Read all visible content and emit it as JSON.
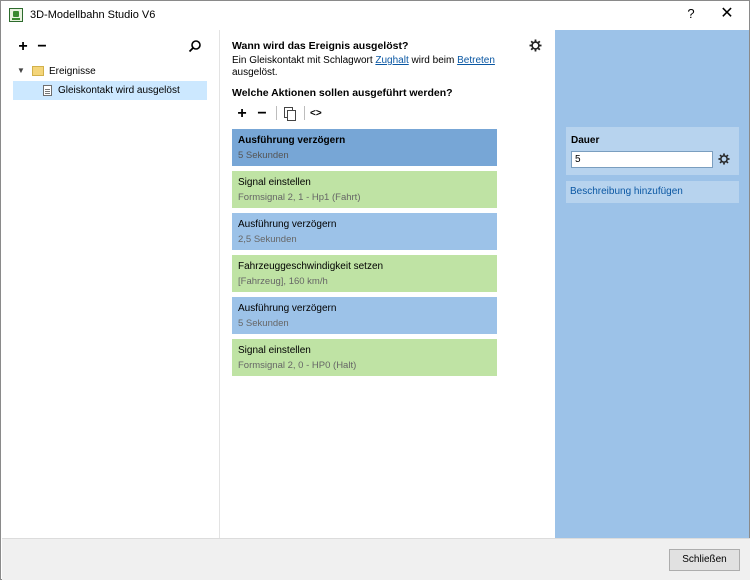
{
  "window": {
    "title": "3D-Modellbahn Studio V6",
    "help_glyph": "?",
    "close_glyph": "✕"
  },
  "tree": {
    "add_glyph": "+",
    "remove_glyph": "−",
    "root_label": "Ereignisse",
    "child_label": "Gleiskontakt wird ausgelöst"
  },
  "trigger": {
    "heading": "Wann wird das Ereignis ausgelöst?",
    "text_part1": "Ein Gleiskontakt mit Schlagwort ",
    "link1": "Zughalt",
    "text_part2": " wird beim ",
    "link2": "Betreten",
    "text_part3": "ausgelöst."
  },
  "actions_section": {
    "heading": "Welche Aktionen sollen ausgeführt werden?",
    "add_glyph": "+",
    "remove_glyph": "−",
    "code_glyph": "<>"
  },
  "actions": [
    {
      "title": "Ausführung verzögern",
      "sub": "5 Sekunden",
      "kind": "blue",
      "selected": true
    },
    {
      "title": "Signal einstellen",
      "sub": "Formsignal 2, 1 - Hp1 (Fahrt)",
      "kind": "green",
      "selected": false
    },
    {
      "title": "Ausführung verzögern",
      "sub": "2,5 Sekunden",
      "kind": "blue",
      "selected": false
    },
    {
      "title": "Fahrzeuggeschwindigkeit setzen",
      "sub": "[Fahrzeug], 160 km/h",
      "kind": "green",
      "selected": false
    },
    {
      "title": "Ausführung verzögern",
      "sub": "5 Sekunden",
      "kind": "blue",
      "selected": false
    },
    {
      "title": "Signal einstellen",
      "sub": "Formsignal 2, 0 - HP0 (Halt)",
      "kind": "green",
      "selected": false
    }
  ],
  "properties": {
    "label": "Dauer",
    "value": "5",
    "description_link": "Beschreibung hinzufügen"
  },
  "footer": {
    "close_label": "Schließen"
  },
  "colors": {
    "blue_action": "#9cc2e8",
    "blue_selected": "#77a6d6",
    "green_action": "#bfe3a4",
    "right_panel": "#9cc2e8",
    "link": "#0a57a3"
  }
}
